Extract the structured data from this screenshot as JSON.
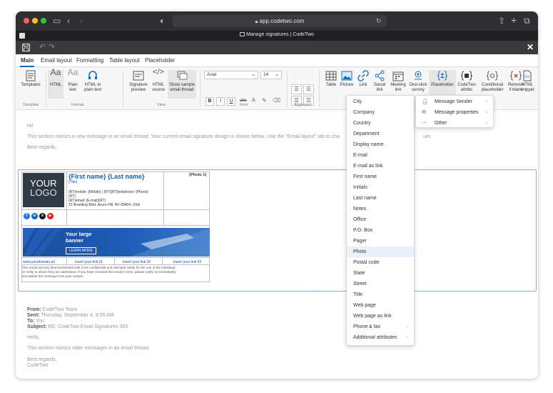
{
  "browser": {
    "url": "app.codetwo.com",
    "tab_title": "Manage signatures | CodeTwo"
  },
  "ribbon_tabs": [
    "Main",
    "Email layout",
    "Formatting",
    "Table layout",
    "Placeholder"
  ],
  "ribbon": {
    "templates": "Templates",
    "html": "HTML",
    "plain_text_1": "Plain",
    "plain_text_2": "text",
    "html_to_plain_1": "HTML to",
    "html_to_plain_2": "plain text",
    "sig_preview_1": "Signature",
    "sig_preview_2": "preview",
    "html_source_1": "HTML",
    "html_source_2": "source",
    "show_sample_1": "Show sample",
    "show_sample_2": "email thread",
    "font_name": "Arial",
    "font_size": "14",
    "table": "Table",
    "picture": "Picture",
    "link": "Link",
    "social_1": "Social",
    "social_2": "link",
    "meeting_1": "Meeting",
    "meeting_2": "link",
    "oneclick_1": "One-click",
    "oneclick_2": "survey",
    "placeholder": "Placeholder",
    "codetwo_1": "CodeTwo",
    "codetwo_2": "attribs",
    "conditional_1": "Conditional",
    "conditional_2": "placeholder",
    "remove_1": "Remove",
    "remove_2": "if blank",
    "snippet_1": "HTML",
    "snippet_2": "snippet",
    "groups": {
      "template": "Template",
      "format": "Format",
      "view": "View",
      "font": "Font",
      "alignment": "Alignment"
    }
  },
  "content": {
    "hi": "Hi!",
    "intro": "This section mimics a new message in an email thread. Your current email signature design is shown below. Use the \"Email layout\" tab to cha",
    "intro_end": "ure.",
    "regards": "Best regards,",
    "signature": {
      "logo_line1": "YOUR",
      "logo_line2": "LOGO",
      "name": "{First name} {Last name}",
      "title": "{Title}",
      "photo": "{Photo 1}",
      "line1": "{RT}mobile: {Mobile} | {RT}{RT}telephone: {Phone}",
      "line2": "{RT}",
      "line3": "{RT}email: {E-mail}{RT}",
      "address": "22 Branding Blvd, Azure Hill, NV 89404, USA",
      "banner_line1": "Your large",
      "banner_line2": "banner",
      "learn_more": "LEARN MORE",
      "website": "www.yourdomain.url",
      "link1": "insert your link 01",
      "link2": "insert your link 02",
      "link3": "insert your link 03",
      "disclaimer1": "This email and any files transmitted with it are confidential and intended solely for the use of the individual",
      "disclaimer2": "or entity to whom they are addressed. If you have received this email in error, please notify us immediately",
      "disclaimer3": "and delete the message from your system."
    },
    "from_label": "From:",
    "from_value": "CodeTwo Team",
    "sent_label": "Sent:",
    "sent_value": "Thursday, September 4, 9:35 AM",
    "to_label": "To:",
    "to_value": "You",
    "subject_label": "Subject:",
    "subject_value": "RE: CodeTwo Email Signatures 365",
    "hello": "Hello,",
    "older": "This section mimics older messages in an email thread.",
    "regards2": "Best regards,",
    "codetwo": "CodeTwo"
  },
  "dropdown": [
    "City",
    "Company",
    "Country",
    "Department",
    "Display name",
    "E-mail",
    "E-mail as link",
    "First name",
    "Initials",
    "Last name",
    "Notes",
    "Office",
    "P.O. Box",
    "Pager",
    "Photo",
    "Postal code",
    "State",
    "Street",
    "Title",
    "Web page",
    "Web page as link",
    "Phone & fax",
    "Additional attributes"
  ],
  "submenu": [
    "Message Sender",
    "Message properties",
    "Other"
  ],
  "colors": {
    "accent": "#0f6cbd",
    "highlight": "#e9f1fb"
  }
}
